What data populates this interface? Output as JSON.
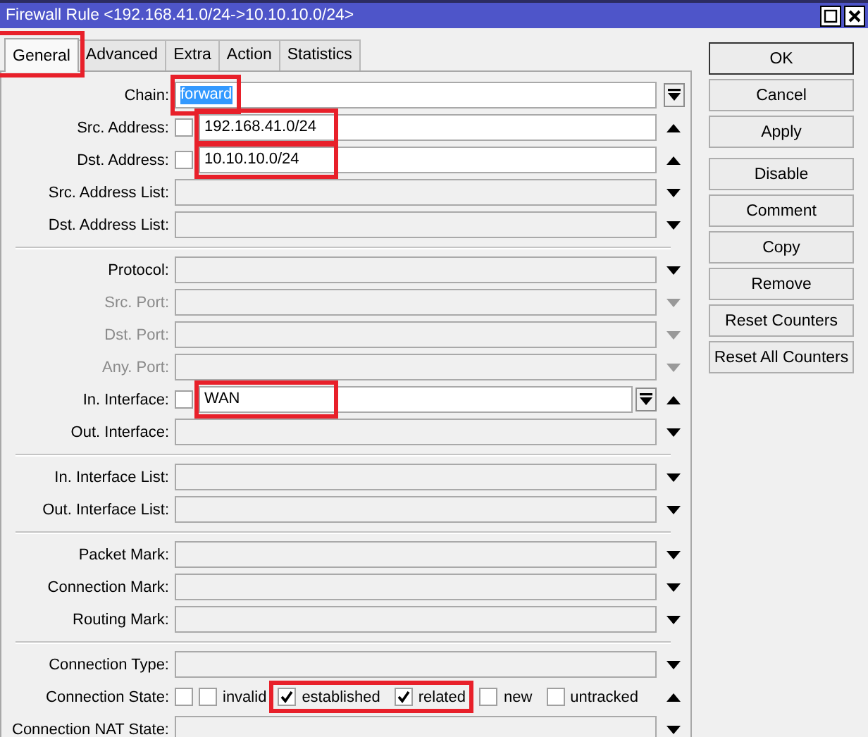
{
  "window": {
    "title": "Firewall Rule <192.168.41.0/24->10.10.10.0/24>"
  },
  "tabs": [
    {
      "label": "General",
      "selected": true,
      "highlighted": true
    },
    {
      "label": "Advanced",
      "selected": false,
      "highlighted": false
    },
    {
      "label": "Extra",
      "selected": false,
      "highlighted": false
    },
    {
      "label": "Action",
      "selected": false,
      "highlighted": false
    },
    {
      "label": "Statistics",
      "selected": false,
      "highlighted": false
    }
  ],
  "sections": [
    {
      "rows": [
        {
          "kind": "field",
          "label": "Chain:",
          "value": "forward",
          "value_selected": true,
          "highlighted": true,
          "disabled": false,
          "dropdown": true
        },
        {
          "kind": "field",
          "label": "Src. Address:",
          "negated": false,
          "value": "192.168.41.0/24",
          "value_selected": false,
          "highlighted": true,
          "disabled": false,
          "arrow_up": true
        },
        {
          "kind": "field",
          "label": "Dst. Address:",
          "negated": false,
          "value": "10.10.10.0/24",
          "value_selected": false,
          "highlighted": true,
          "disabled": false,
          "arrow_up": true
        },
        {
          "kind": "field",
          "label": "Src. Address List:",
          "disabled": false,
          "arrow_up": false
        },
        {
          "kind": "field",
          "label": "Dst. Address List:",
          "disabled": false,
          "arrow_up": false
        }
      ]
    },
    {
      "rows": [
        {
          "kind": "field",
          "label": "Protocol:",
          "disabled": false,
          "arrow_up": false
        },
        {
          "kind": "field",
          "label": "Src. Port:",
          "disabled": true,
          "arrow_up": false
        },
        {
          "kind": "field",
          "label": "Dst. Port:",
          "disabled": true,
          "arrow_up": false
        },
        {
          "kind": "field",
          "label": "Any. Port:",
          "disabled": true,
          "arrow_up": false
        },
        {
          "kind": "field",
          "label": "In. Interface:",
          "negated": false,
          "value": "WAN",
          "value_selected": false,
          "highlighted": true,
          "disabled": false,
          "dropdown": true,
          "arrow_up": true
        },
        {
          "kind": "field",
          "label": "Out. Interface:",
          "disabled": false,
          "arrow_up": false
        }
      ]
    },
    {
      "rows": [
        {
          "kind": "field",
          "label": "In. Interface List:",
          "disabled": false,
          "arrow_up": false
        },
        {
          "kind": "field",
          "label": "Out. Interface List:",
          "disabled": false,
          "arrow_up": false
        }
      ]
    },
    {
      "rows": [
        {
          "kind": "field",
          "label": "Packet Mark:",
          "disabled": false,
          "arrow_up": false
        },
        {
          "kind": "field",
          "label": "Connection Mark:",
          "disabled": false,
          "arrow_up": false
        },
        {
          "kind": "field",
          "label": "Routing Mark:",
          "disabled": false,
          "arrow_up": false
        }
      ]
    },
    {
      "rows": [
        {
          "kind": "field",
          "label": "Connection Type:",
          "disabled": false,
          "arrow_up": false
        },
        {
          "kind": "checks",
          "label": "Connection State:",
          "negated": false,
          "disabled": false,
          "arrow_up": true,
          "options": [
            {
              "label": "invalid",
              "checked": false
            },
            {
              "label": "established",
              "checked": true,
              "highlighted": true
            },
            {
              "label": "related",
              "checked": true,
              "highlighted": true
            },
            {
              "label": "new",
              "checked": false
            },
            {
              "label": "untracked",
              "checked": false
            }
          ]
        },
        {
          "kind": "field",
          "label": "Connection NAT State:",
          "disabled": false,
          "arrow_up": false
        }
      ]
    }
  ],
  "button_groups": [
    {
      "buttons": [
        {
          "label": "OK",
          "default": true
        },
        {
          "label": "Cancel",
          "default": false
        },
        {
          "label": "Apply",
          "default": false
        }
      ]
    },
    {
      "buttons": [
        {
          "label": "Disable",
          "default": false
        },
        {
          "label": "Comment",
          "default": false
        },
        {
          "label": "Copy",
          "default": false
        },
        {
          "label": "Remove",
          "default": false
        },
        {
          "label": "Reset Counters",
          "default": false
        },
        {
          "label": "Reset All Counters",
          "default": false
        }
      ]
    }
  ]
}
